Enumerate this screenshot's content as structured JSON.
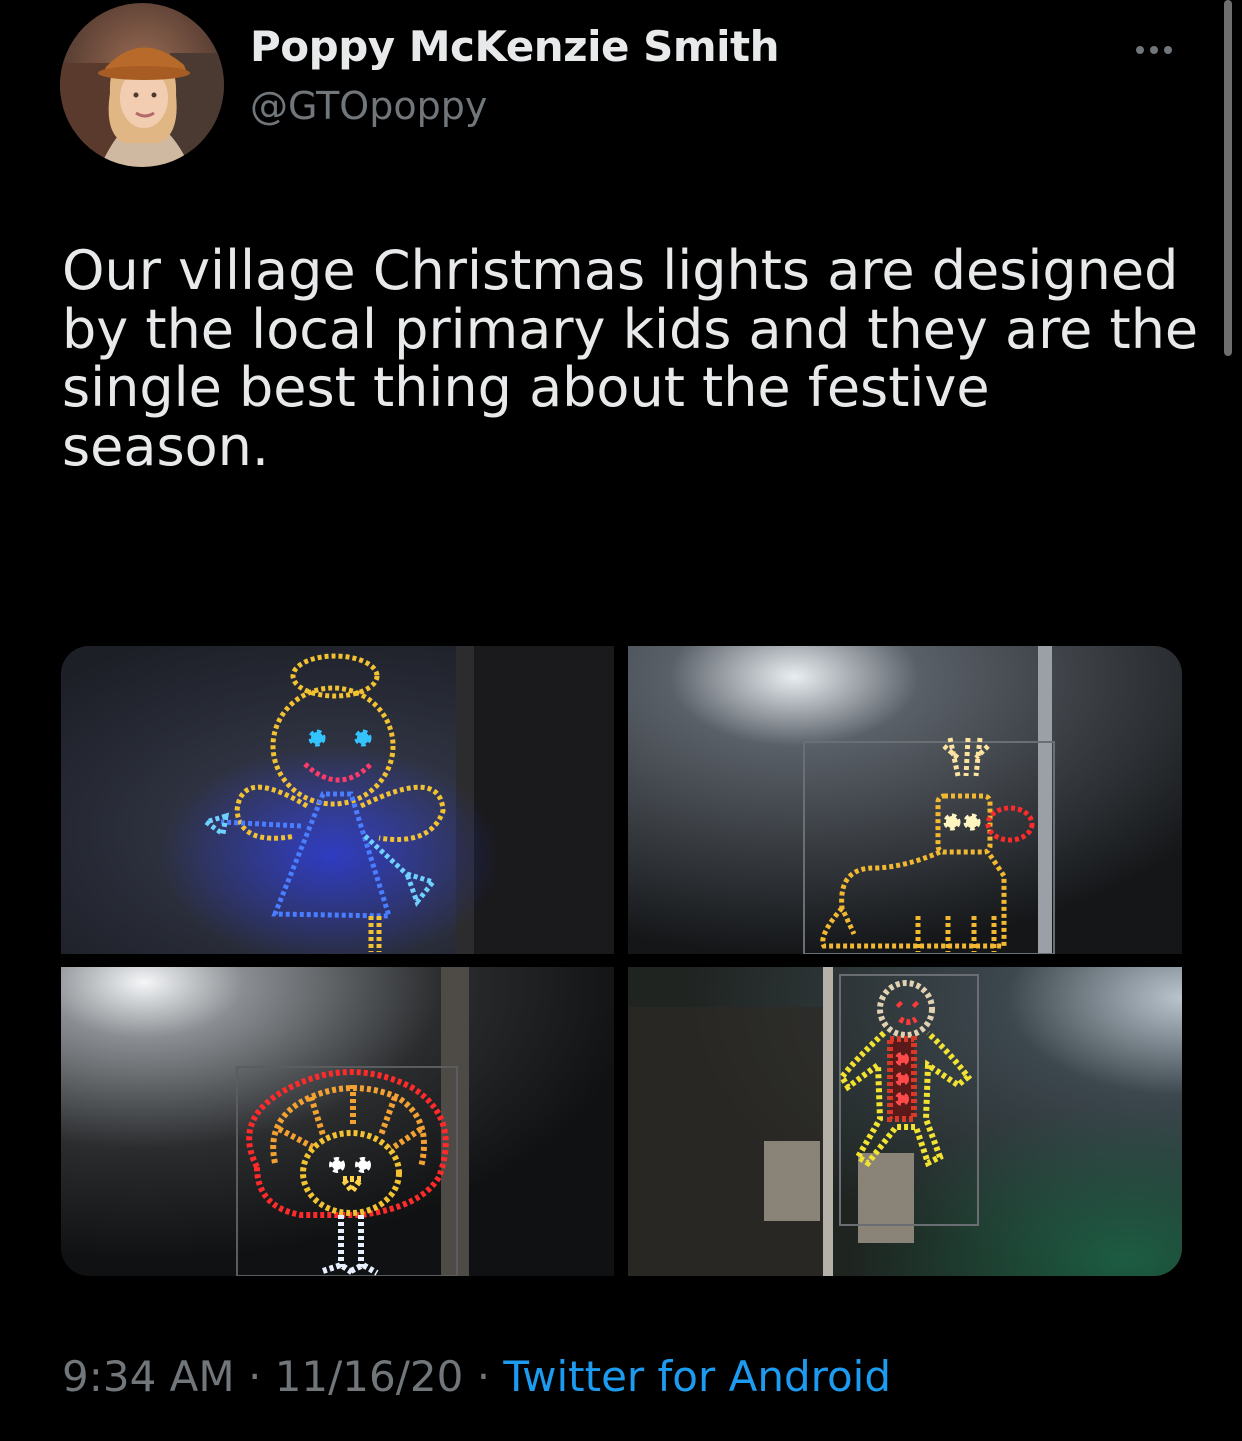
{
  "tweet": {
    "author": {
      "display_name": "Poppy McKenzie Smith",
      "handle": "@GTOpoppy"
    },
    "text": "Our village Christmas lights are designed by the local primary kids and they are the single best thing about the festive season.",
    "media": [
      {
        "subject": "angel"
      },
      {
        "subject": "reindeer"
      },
      {
        "subject": "turkey"
      },
      {
        "subject": "gingerbread man"
      }
    ],
    "meta": {
      "time": "9:34 AM",
      "sep1": " · ",
      "date": "11/16/20",
      "sep2": " · ",
      "source": "Twitter for Android"
    }
  },
  "colors": {
    "background": "#000000",
    "text": "#e7e9ea",
    "muted": "#71767b",
    "link": "#1d9bf0"
  },
  "icons": {
    "more": "more-horizontal-icon"
  }
}
